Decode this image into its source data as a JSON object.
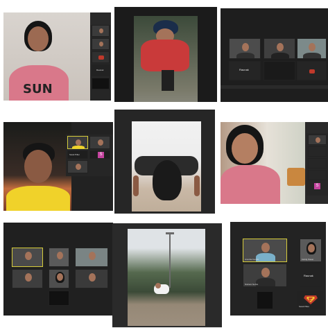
{
  "collage": {
    "tiles": [
      {
        "id": "t1",
        "participants": [
          "",
          "",
          "Raunak"
        ]
      },
      {
        "id": "t2"
      },
      {
        "id": "t3",
        "participants": [
          "",
          "",
          "",
          "Raunak"
        ]
      },
      {
        "id": "t4",
        "participants": [
          "",
          "",
          "Swati Pillai",
          "",
          "S"
        ]
      },
      {
        "id": "t5"
      },
      {
        "id": "t6",
        "participants": [
          "",
          "S"
        ]
      },
      {
        "id": "t7",
        "participants": [
          "",
          "",
          "",
          "",
          "",
          ""
        ]
      },
      {
        "id": "t8"
      },
      {
        "id": "t9",
        "participants": [
          "",
          "",
          "Anusha Kondle",
          "Nishant Nehra",
          "Raunak",
          "Kshitij Pawar",
          "Swati Pillai"
        ]
      }
    ]
  },
  "labels": {
    "t1_raunak": "Raunak",
    "t3_raunak": "Raunak",
    "t4_swati": "Swati Pillai",
    "t4_s": "S",
    "t6_s": "S",
    "t9_anusha": "Anusha Kondle",
    "t9_nishant": "Nishant Nehra",
    "t9_raunak": "Raunak",
    "t9_kshitij": "Kshitij Pawar",
    "t9_swati": "Swati Pillai"
  },
  "colors": {
    "zoom_bg": "#1b1b1b",
    "thumb_bg": "#3b3b3b",
    "active_speaker_border": "#d6cc3a",
    "avatar_s": "#c4439e",
    "pink_shirt": "#d9788a",
    "red_shirt": "#c93a3a",
    "yellow_shirt": "#f0d22a"
  },
  "icons": [
    "message-bubble-icon",
    "superman-logo-icon",
    "s-avatar-icon"
  ]
}
